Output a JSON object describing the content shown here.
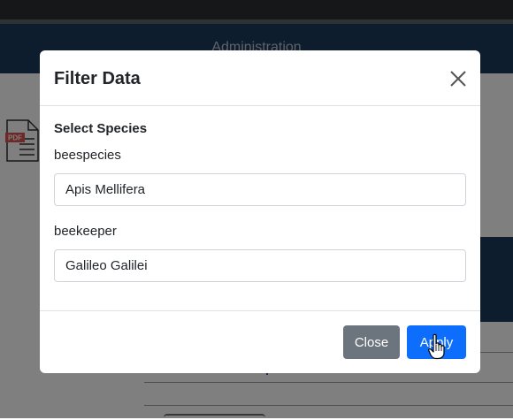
{
  "background": {
    "navbar_title": "Administration"
  },
  "modal": {
    "title": "Filter Data",
    "section_title": "Select Species",
    "fields": [
      {
        "label": "beespecies",
        "value": "Apis Mellifera"
      },
      {
        "label": "beekeeper",
        "value": "Galileo Galilei"
      }
    ],
    "buttons": {
      "close_label": "Close",
      "apply_label": "Apply"
    },
    "close_icon": "close-icon"
  },
  "colors": {
    "navbar": "#1d3a5c",
    "primary": "#0d6efd",
    "secondary": "#6c757d"
  }
}
